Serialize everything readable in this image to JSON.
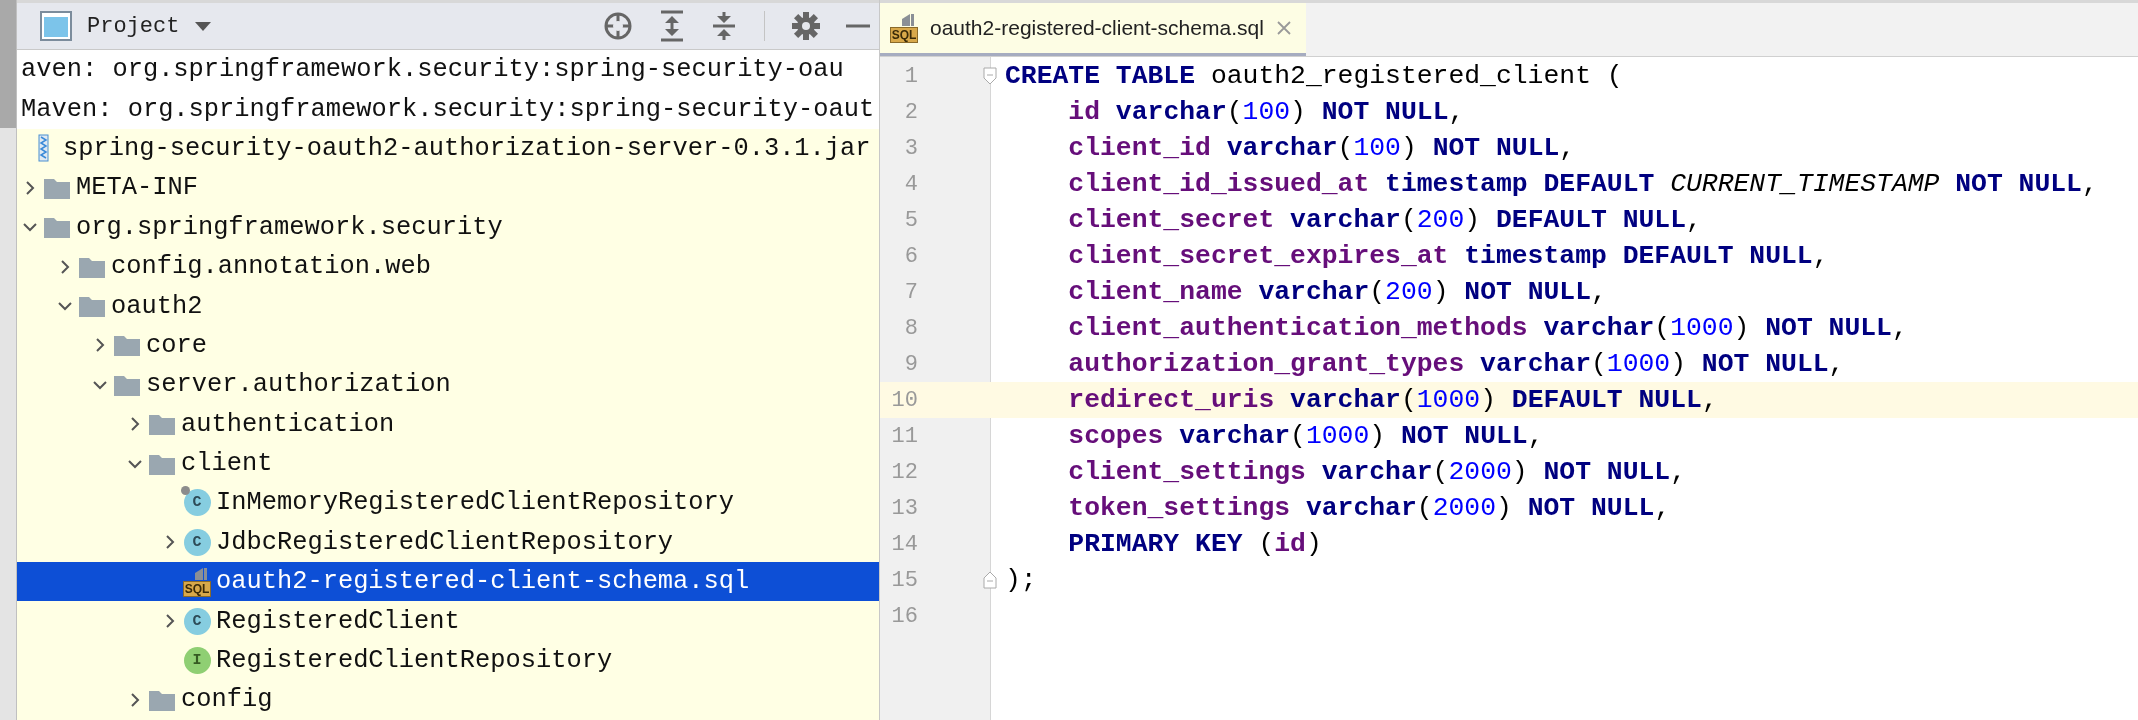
{
  "project_panel": {
    "title": "Project"
  },
  "tree": [
    {
      "label": "aven: org.springframework.security:spring-security-oau",
      "kind": "library",
      "selected": false
    },
    {
      "label": "Maven: org.springframework.security:spring-security-oaut",
      "kind": "library",
      "selected": false
    },
    {
      "label": "spring-security-oauth2-authorization-server-0.3.1.jar",
      "kind": "archive",
      "selected": false,
      "children": [
        {
          "label": "META-INF",
          "kind": "folder",
          "expanded": false,
          "selected": false
        },
        {
          "label": "org.springframework.security",
          "kind": "folder",
          "expanded": true,
          "selected": false,
          "children": [
            {
              "label": "config.annotation.web",
              "kind": "folder",
              "expanded": false,
              "selected": false
            },
            {
              "label": "oauth2",
              "kind": "folder",
              "expanded": true,
              "selected": false,
              "children": [
                {
                  "label": "core",
                  "kind": "folder",
                  "expanded": false,
                  "selected": false
                },
                {
                  "label": "server.authorization",
                  "kind": "folder",
                  "expanded": true,
                  "selected": false,
                  "children": [
                    {
                      "label": "authentication",
                      "kind": "folder",
                      "expanded": false,
                      "selected": false
                    },
                    {
                      "label": "client",
                      "kind": "folder",
                      "expanded": true,
                      "selected": false,
                      "children": [
                        {
                          "label": "InMemoryRegisteredClientRepository",
                          "kind": "abstract-class",
                          "icon_text": "C",
                          "selected": false
                        },
                        {
                          "label": "JdbcRegisteredClientRepository",
                          "kind": "class",
                          "icon_text": "C",
                          "expanded": false,
                          "selected": false
                        },
                        {
                          "label": "oauth2-registered-client-schema.sql",
                          "kind": "sql",
                          "icon_text": "SQL",
                          "selected": true
                        },
                        {
                          "label": "RegisteredClient",
                          "kind": "class",
                          "icon_text": "C",
                          "expanded": false,
                          "selected": false
                        },
                        {
                          "label": "RegisteredClientRepository",
                          "kind": "interface",
                          "icon_text": "I",
                          "selected": false
                        }
                      ]
                    },
                    {
                      "label": "config",
                      "kind": "folder",
                      "expanded": false,
                      "selected": false
                    }
                  ]
                }
              ]
            }
          ]
        }
      ]
    }
  ],
  "editor": {
    "tabs": [
      {
        "label": "oauth2-registered-client-schema.sql",
        "icon_text": "SQL",
        "selected": true
      }
    ],
    "lines": [
      {
        "number": "1",
        "current": false,
        "fold_start": true,
        "fold_end": false,
        "tokens": [
          {
            "kind": "keyword",
            "text": "CREATE TABLE"
          },
          {
            "kind": "plain",
            "text": " oauth2_registered_client ("
          }
        ]
      },
      {
        "number": "2",
        "current": false,
        "fold_start": false,
        "fold_end": false,
        "tokens": [
          {
            "kind": "column",
            "text": "    id"
          },
          {
            "kind": "keyword",
            "text": " varchar"
          },
          {
            "kind": "plain",
            "text": "("
          },
          {
            "kind": "number",
            "text": "100"
          },
          {
            "kind": "plain",
            "text": ")"
          },
          {
            "kind": "keyword",
            "text": " NOT NULL"
          },
          {
            "kind": "plain",
            "text": ","
          }
        ]
      },
      {
        "number": "3",
        "current": false,
        "fold_start": false,
        "fold_end": false,
        "tokens": [
          {
            "kind": "column",
            "text": "    client_id"
          },
          {
            "kind": "keyword",
            "text": " varchar"
          },
          {
            "kind": "plain",
            "text": "("
          },
          {
            "kind": "number",
            "text": "100"
          },
          {
            "kind": "plain",
            "text": ")"
          },
          {
            "kind": "keyword",
            "text": " NOT NULL"
          },
          {
            "kind": "plain",
            "text": ","
          }
        ]
      },
      {
        "number": "4",
        "current": false,
        "fold_start": false,
        "fold_end": false,
        "tokens": [
          {
            "kind": "column",
            "text": "    client_id_issued_at"
          },
          {
            "kind": "keyword",
            "text": " timestamp DEFAULT"
          },
          {
            "kind": "italic",
            "text": " CURRENT_TIMESTAMP"
          },
          {
            "kind": "keyword",
            "text": " NOT NULL"
          },
          {
            "kind": "plain",
            "text": ","
          }
        ]
      },
      {
        "number": "5",
        "current": false,
        "fold_start": false,
        "fold_end": false,
        "tokens": [
          {
            "kind": "column",
            "text": "    client_secret"
          },
          {
            "kind": "keyword",
            "text": " varchar"
          },
          {
            "kind": "plain",
            "text": "("
          },
          {
            "kind": "number",
            "text": "200"
          },
          {
            "kind": "plain",
            "text": ")"
          },
          {
            "kind": "keyword",
            "text": " DEFAULT NULL"
          },
          {
            "kind": "plain",
            "text": ","
          }
        ]
      },
      {
        "number": "6",
        "current": false,
        "fold_start": false,
        "fold_end": false,
        "tokens": [
          {
            "kind": "column",
            "text": "    client_secret_expires_at"
          },
          {
            "kind": "keyword",
            "text": " timestamp DEFAULT NULL"
          },
          {
            "kind": "plain",
            "text": ","
          }
        ]
      },
      {
        "number": "7",
        "current": false,
        "fold_start": false,
        "fold_end": false,
        "tokens": [
          {
            "kind": "column",
            "text": "    client_name"
          },
          {
            "kind": "keyword",
            "text": " varchar"
          },
          {
            "kind": "plain",
            "text": "("
          },
          {
            "kind": "number",
            "text": "200"
          },
          {
            "kind": "plain",
            "text": ")"
          },
          {
            "kind": "keyword",
            "text": " NOT NULL"
          },
          {
            "kind": "plain",
            "text": ","
          }
        ]
      },
      {
        "number": "8",
        "current": false,
        "fold_start": false,
        "fold_end": false,
        "tokens": [
          {
            "kind": "column",
            "text": "    client_authentication_methods"
          },
          {
            "kind": "keyword",
            "text": " varchar"
          },
          {
            "kind": "plain",
            "text": "("
          },
          {
            "kind": "number",
            "text": "1000"
          },
          {
            "kind": "plain",
            "text": ")"
          },
          {
            "kind": "keyword",
            "text": " NOT NULL"
          },
          {
            "kind": "plain",
            "text": ","
          }
        ]
      },
      {
        "number": "9",
        "current": false,
        "fold_start": false,
        "fold_end": false,
        "tokens": [
          {
            "kind": "column",
            "text": "    authorization_grant_types"
          },
          {
            "kind": "keyword",
            "text": " varchar"
          },
          {
            "kind": "plain",
            "text": "("
          },
          {
            "kind": "number",
            "text": "1000"
          },
          {
            "kind": "plain",
            "text": ")"
          },
          {
            "kind": "keyword",
            "text": " NOT NULL"
          },
          {
            "kind": "plain",
            "text": ","
          }
        ]
      },
      {
        "number": "10",
        "current": true,
        "fold_start": false,
        "fold_end": false,
        "tokens": [
          {
            "kind": "column",
            "text": "    redirect_uris"
          },
          {
            "kind": "keyword",
            "text": " varchar"
          },
          {
            "kind": "plain",
            "text": "("
          },
          {
            "kind": "number",
            "text": "1000"
          },
          {
            "kind": "plain",
            "text": ")"
          },
          {
            "kind": "keyword",
            "text": " DEFAULT NULL"
          },
          {
            "kind": "plain",
            "text": ","
          }
        ]
      },
      {
        "number": "11",
        "current": false,
        "fold_start": false,
        "fold_end": false,
        "tokens": [
          {
            "kind": "column",
            "text": "    scopes"
          },
          {
            "kind": "keyword",
            "text": " varchar"
          },
          {
            "kind": "plain",
            "text": "("
          },
          {
            "kind": "number",
            "text": "1000"
          },
          {
            "kind": "plain",
            "text": ")"
          },
          {
            "kind": "keyword",
            "text": " NOT NULL"
          },
          {
            "kind": "plain",
            "text": ","
          }
        ]
      },
      {
        "number": "12",
        "current": false,
        "fold_start": false,
        "fold_end": false,
        "tokens": [
          {
            "kind": "column",
            "text": "    client_settings"
          },
          {
            "kind": "keyword",
            "text": " varchar"
          },
          {
            "kind": "plain",
            "text": "("
          },
          {
            "kind": "number",
            "text": "2000"
          },
          {
            "kind": "plain",
            "text": ")"
          },
          {
            "kind": "keyword",
            "text": " NOT NULL"
          },
          {
            "kind": "plain",
            "text": ","
          }
        ]
      },
      {
        "number": "13",
        "current": false,
        "fold_start": false,
        "fold_end": false,
        "tokens": [
          {
            "kind": "column",
            "text": "    token_settings"
          },
          {
            "kind": "keyword",
            "text": " varchar"
          },
          {
            "kind": "plain",
            "text": "("
          },
          {
            "kind": "number",
            "text": "2000"
          },
          {
            "kind": "plain",
            "text": ")"
          },
          {
            "kind": "keyword",
            "text": " NOT NULL"
          },
          {
            "kind": "plain",
            "text": ","
          }
        ]
      },
      {
        "number": "14",
        "current": false,
        "fold_start": false,
        "fold_end": false,
        "tokens": [
          {
            "kind": "keyword",
            "text": "    PRIMARY KEY"
          },
          {
            "kind": "plain",
            "text": " ("
          },
          {
            "kind": "column",
            "text": "id"
          },
          {
            "kind": "plain",
            "text": ")"
          }
        ]
      },
      {
        "number": "15",
        "current": false,
        "fold_start": false,
        "fold_end": true,
        "tokens": [
          {
            "kind": "plain",
            "text": ");"
          }
        ]
      },
      {
        "number": "16",
        "current": false,
        "fold_start": false,
        "fold_end": false
      }
    ]
  }
}
